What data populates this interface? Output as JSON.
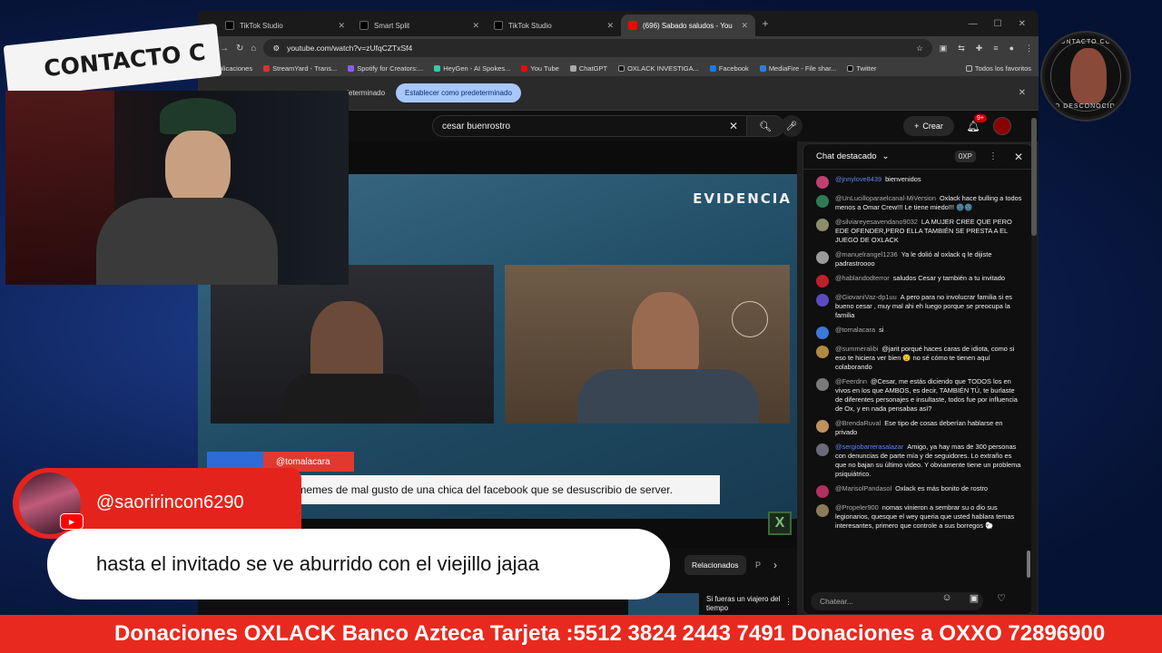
{
  "browser": {
    "tabs": [
      {
        "title": "TikTok Studio",
        "active": false
      },
      {
        "title": "Smart Split",
        "active": false
      },
      {
        "title": "TikTok Studio",
        "active": false
      },
      {
        "title": "(696) Sabado saludos - You",
        "active": true
      }
    ],
    "url": "youtube.com/watch?v=zUfqCZTxSf4",
    "bookmarks": [
      "Aplicaciones",
      "StreamYard - Trans...",
      "Spotify for Creators:...",
      "HeyGen - AI Spokes...",
      "You Tube",
      "ChatGPT",
      "OXLACK INVESTIGA...",
      "Facebook",
      "MediaFire - File shar...",
      "Twitter"
    ],
    "bookmarks_folder": "Todos los favoritos",
    "infobar_text": "predeterminado",
    "infobar_button": "Establecer como predeterminado"
  },
  "youtube": {
    "search_value": "cesar buenrostro",
    "create_label": "Crear",
    "notif_count": "9+",
    "brand_overlay": "EVIDENCIA",
    "lower_third_tag": "@tomalacara",
    "lower_third_text": "s memes de mal gusto de una chica del facebook que se desuscribio de server.",
    "relacionados": "Relacionados",
    "chip_partial": "P",
    "related_title": "Si fueras un viajero del tiempo"
  },
  "chat": {
    "title": "Chat destacado",
    "xp": "0XP",
    "input_placeholder": "Chatear...",
    "messages": [
      {
        "user": "@jnnylove8439",
        "text": "bienvenidos",
        "color": "#c04070",
        "blue": true
      },
      {
        "user": "@UnLucilloparaelcanal-MiVersion",
        "text": "Oxlack hace bulling a todos menos a Omar Crew!!! Le tiene miedo!!! 🌚🌚",
        "color": "#2f7a55",
        "blue": false
      },
      {
        "user": "@silviareyesavendano9032",
        "text": "LA MUJER CREE QUE PERO EDE OFENDER,PERO ELLA TAMBIÉN SE PRESTA A EL JUEGO DE OXLACK",
        "color": "#8d8d6a",
        "blue": false
      },
      {
        "user": "@manuelrangel1236",
        "text": "Ya le dolió al oxlack q le dijiste padrastroooo",
        "color": "#9a9a9a",
        "blue": false
      },
      {
        "user": "@hablandodterror",
        "text": "saludos Cesar y también a tu invitado",
        "color": "#c0202a",
        "blue": false
      },
      {
        "user": "@GiovaniVaz-dp1uu",
        "text": "A pero para no involucrar familia si es bueno cesar , muy mal ahi eh luego porque se preocupa la familia",
        "color": "#5c4bc0",
        "blue": false
      },
      {
        "user": "@tomalacara",
        "text": "si",
        "color": "#3c78d8",
        "blue": false
      },
      {
        "user": "@summeralibi",
        "text": "@jarit porqué haces caras de idiota, como si eso te hiciera ver bien 😟 no sé cómo te tienen aquí colaborando",
        "color": "#b08a40",
        "blue": false
      },
      {
        "user": "@Feerdnn",
        "text": "@Cesar, me estás diciendo que TODOS los en vivos en los que AMBOS, es decir, TAMBIÉN TÚ, te burlaste de diferentes personajes e insultaste, todos fue por influencia de Ox, y en nada pensabas así?",
        "color": "#7a7a7a",
        "blue": false
      },
      {
        "user": "@BrendaRuval",
        "text": "Ese tipo de cosas deberían hablarse en privado",
        "color": "#c09060",
        "blue": false
      },
      {
        "user": "@sergiobarrerasalazar",
        "text": "Amigo, ya hay mas de 300 personas con denuncias de parte mía y de seguidores. Lo extraño es que no bajan su último video. Y obviamente tiene un problema psiquiátrico.",
        "color": "#6a6a7a",
        "blue": true
      },
      {
        "user": "@MarisolPandasol",
        "text": "Oxlack es más bonito de rostro",
        "color": "#b03060",
        "blue": false
      },
      {
        "user": "@Propeler900",
        "text": "nomas vinieron a sembrar su o dio sus legionarios, quesque el wey queria que usted hablara temas interesantes, primero que controle a sus borregos 🐑",
        "color": "#8a7a5a",
        "blue": false
      }
    ]
  },
  "overlay": {
    "banner": "CONTACTO C",
    "logo_top": "CONTACTO CON",
    "logo_bottom": "LO DESCONOCIDO",
    "comment_user": "@saoririncon6290",
    "comment_text": "hasta el invitado se ve aburrido con el viejillo jajaa",
    "ticker": "Donaciones OXLACK Banco Azteca Tarjeta :5512 3824 2443 7491 Donaciones a OXXO 72896900"
  },
  "colors": {
    "ticker_bg": "#e8291f",
    "comment_pill": "#e4241c",
    "yt_red": "#ff0000"
  }
}
